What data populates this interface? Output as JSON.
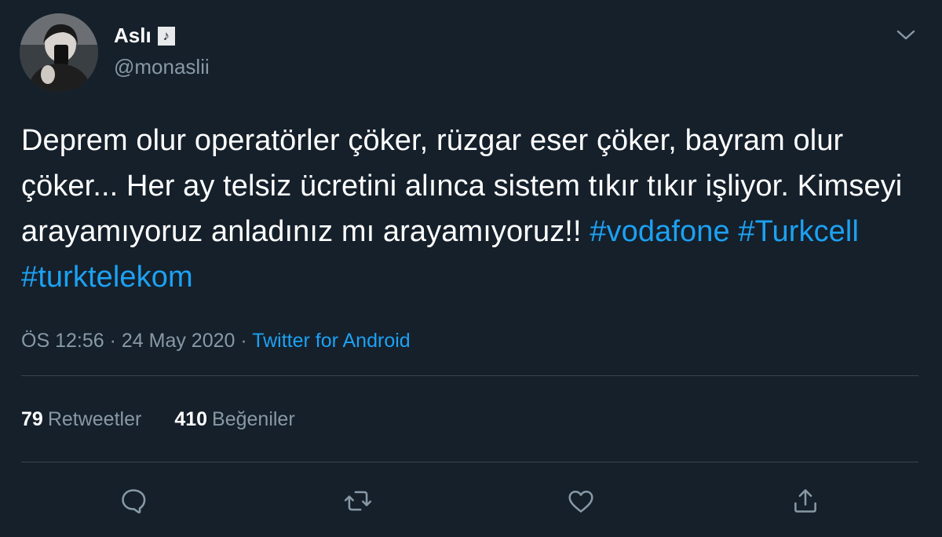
{
  "user": {
    "name": "Aslı",
    "name_badge": "♪",
    "handle": "@monaslii"
  },
  "tweet": {
    "text_plain": "Deprem olur operatörler çöker, rüzgar eser çöker, bayram olur çöker... Her ay telsiz ücretini alınca sistem tıkır tıkır işliyor. Kimseyi arayamıyoruz anladınız mı arayamıyoruz!!",
    "hashtags": [
      "#vodafone",
      "#Turkcell",
      "#turktelekom"
    ]
  },
  "meta": {
    "time": "ÖS 12:56",
    "separator": "·",
    "date": "24 May 2020",
    "source": "Twitter for Android"
  },
  "stats": {
    "retweets_count": "79",
    "retweets_label": "Retweetler",
    "likes_count": "410",
    "likes_label": "Beğeniler"
  },
  "icons": {
    "menu": "chevron-down-icon",
    "reply": "reply-icon",
    "retweet": "retweet-icon",
    "like": "heart-icon",
    "share": "share-icon"
  },
  "colors": {
    "background": "#15202b",
    "text": "#ffffff",
    "secondary": "#8899a6",
    "accent": "#1da1f2",
    "divider": "#38444d"
  }
}
